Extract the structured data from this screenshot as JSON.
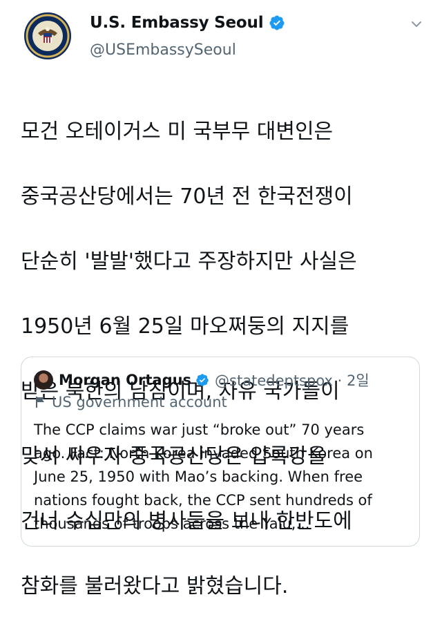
{
  "tweet": {
    "author_name": "U.S. Embassy Seoul",
    "author_handle": "@USEmbassySeoul",
    "avatar_icon": "embassy-seal-icon",
    "verified_icon": "verified-badge-icon",
    "menu_icon": "chevron-down-icon",
    "body_lines": [
      "모건 오테이거스 미 국부무 대변인은",
      "중국공산당에서는 70년 전 한국전쟁이",
      "단순히 '발발'했다고 주장하지만 사실은",
      "1950년 6월 25일 마오쩌둥의 지지를",
      "받은 북한의 남침이며, 자유 국가들이",
      "맞서 싸우자 중국공산당은 압록강을",
      "건너 수십만의 병사들을 보내 한반도에",
      "참화를 불러왔다고 밝혔습니다."
    ]
  },
  "quoted_tweet": {
    "author_name": "Morgan Ortagus",
    "author_handle": "@statedeptspox · 2일",
    "account_label": "US government account",
    "label_icon": "flag-icon",
    "text_lines": [
      "The CCP claims war just “broke out” 70 years",
      "ago. Fact: North Korea invaded South Korea on",
      "June 25, 1950 with Mao’s backing. When free",
      "nations fought back, the CCP sent hundreds of",
      "thousands of troops across the Yalu,..."
    ]
  },
  "colors": {
    "accent": "#1d9bf0",
    "text": "#0f1419",
    "secondary": "#536471",
    "border": "#cfd9de"
  }
}
